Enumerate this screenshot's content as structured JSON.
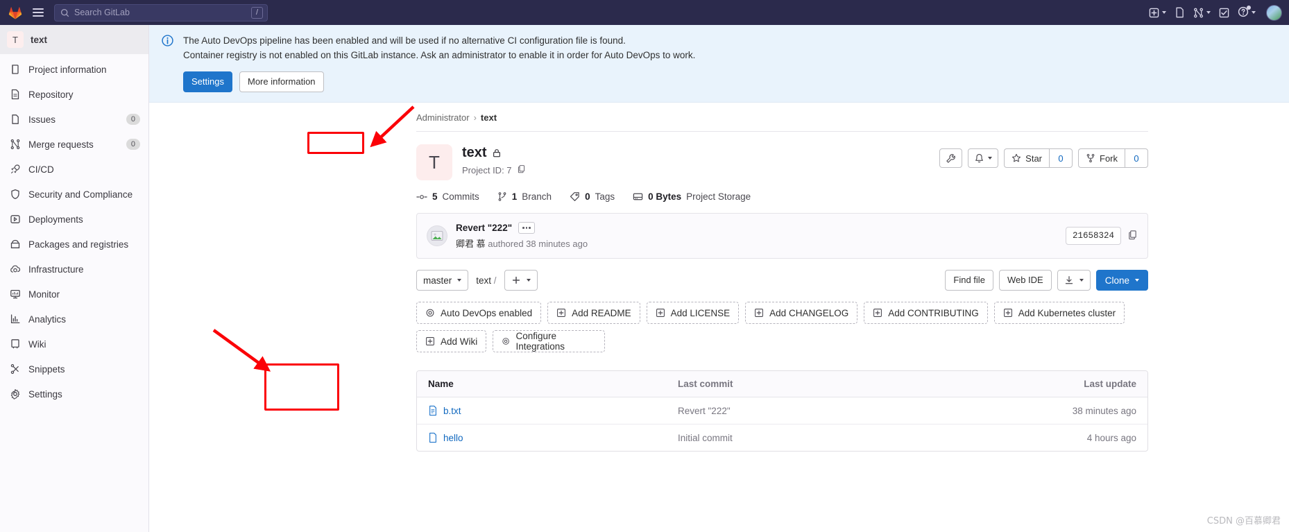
{
  "topnav": {
    "logo_icon": "gitlab-logo-icon",
    "menu_icon": "hamburger-menu-icon",
    "search": {
      "placeholder": "Search GitLab",
      "shortcut": "/"
    },
    "actions": [
      {
        "name": "create-new-menu",
        "icon": "plus-square-icon",
        "caret": true
      },
      {
        "name": "issues-link",
        "icon": "issues-icon",
        "caret": false
      },
      {
        "name": "merge-requests-menu",
        "icon": "merge-request-icon",
        "caret": true
      },
      {
        "name": "todos-link",
        "icon": "todo-check-icon",
        "caret": false
      },
      {
        "name": "help-menu",
        "icon": "question-circle-icon",
        "caret": true
      }
    ],
    "avatar": "user-avatar"
  },
  "sidebar": {
    "project": {
      "initial": "T",
      "name": "text"
    },
    "items": [
      {
        "label": "Project information",
        "icon": "info-book-icon",
        "badge": ""
      },
      {
        "label": "Repository",
        "icon": "document-icon",
        "badge": ""
      },
      {
        "label": "Issues",
        "icon": "issues-icon",
        "badge": "0"
      },
      {
        "label": "Merge requests",
        "icon": "merge-request-icon",
        "badge": "0"
      },
      {
        "label": "CI/CD",
        "icon": "rocket-icon",
        "badge": ""
      },
      {
        "label": "Security and Compliance",
        "icon": "shield-icon",
        "badge": ""
      },
      {
        "label": "Deployments",
        "icon": "deployments-icon",
        "badge": ""
      },
      {
        "label": "Packages and registries",
        "icon": "package-icon",
        "badge": ""
      },
      {
        "label": "Infrastructure",
        "icon": "cloud-gear-icon",
        "badge": ""
      },
      {
        "label": "Monitor",
        "icon": "monitor-icon",
        "badge": ""
      },
      {
        "label": "Analytics",
        "icon": "chart-icon",
        "badge": ""
      },
      {
        "label": "Wiki",
        "icon": "book-icon",
        "badge": ""
      },
      {
        "label": "Snippets",
        "icon": "snippet-icon",
        "badge": ""
      },
      {
        "label": "Settings",
        "icon": "gear-icon",
        "badge": ""
      }
    ]
  },
  "alert": {
    "icon": "info-circle-icon",
    "line1": "The Auto DevOps pipeline has been enabled and will be used if no alternative CI configuration file is found.",
    "line2": "Container registry is not enabled on this GitLab instance. Ask an administrator to enable it in order for Auto DevOps to work.",
    "settings_label": "Settings",
    "more_info_label": "More information"
  },
  "breadcrumb": {
    "owner": "Administrator",
    "separator": "›",
    "project": "text"
  },
  "project": {
    "initial": "T",
    "title": "text",
    "visibility_icon": "lock-icon",
    "project_id_label": "Project ID: 7",
    "copy_icon": "copy-to-clipboard-icon",
    "actions": {
      "wrench_icon": "wrench-icon",
      "notifications_icon": "bell-icon",
      "star_label": "Star",
      "star_count": "0",
      "fork_label": "Fork",
      "fork_count": "0"
    }
  },
  "stats": [
    {
      "icon": "commit-icon",
      "value": "5",
      "label": "Commits"
    },
    {
      "icon": "branch-icon",
      "value": "1",
      "label": "Branch"
    },
    {
      "icon": "tag-icon",
      "value": "0",
      "label": "Tags"
    },
    {
      "icon": "storage-icon",
      "value": "0 Bytes",
      "label": "Project Storage"
    }
  ],
  "last_commit": {
    "avatar": "commit-author-avatar",
    "title": "Revert \"222\"",
    "expand_icon": "ellipsis-icon",
    "author": "卿君 慕",
    "meta_suffix": "authored 38 minutes ago",
    "sha": "21658324",
    "copy_icon": "copy-sha-icon"
  },
  "repo_controls": {
    "branch": "master",
    "path_project": "text",
    "path_slash": "/",
    "add_icon": "plus-icon",
    "find_file": "Find file",
    "web_ide": "Web IDE",
    "download_icon": "download-icon",
    "clone_label": "Clone"
  },
  "setup_buttons": [
    {
      "label": "Auto DevOps enabled",
      "icon": "gear-icon"
    },
    {
      "label": "Add README",
      "icon": "plus-box-icon"
    },
    {
      "label": "Add LICENSE",
      "icon": "plus-box-icon"
    },
    {
      "label": "Add CHANGELOG",
      "icon": "plus-box-icon"
    },
    {
      "label": "Add CONTRIBUTING",
      "icon": "plus-box-icon"
    },
    {
      "label": "Add Kubernetes cluster",
      "icon": "plus-box-icon"
    },
    {
      "label": "Add Wiki",
      "icon": "plus-box-icon"
    },
    {
      "label": "Configure Integrations",
      "icon": "gear-icon"
    }
  ],
  "files": {
    "headers": {
      "name": "Name",
      "last_commit": "Last commit",
      "last_update": "Last update"
    },
    "rows": [
      {
        "name": "b.txt",
        "icon": "text-file-icon",
        "last_commit": "Revert \"222\"",
        "last_update": "38 minutes ago"
      },
      {
        "name": "hello",
        "icon": "file-icon",
        "last_commit": "Initial commit",
        "last_update": "4 hours ago"
      }
    ]
  },
  "annotations": {
    "color": "#fb0007",
    "title_box": "highlight-project-title",
    "title_arrow": "arrow-to-project-title",
    "files_box": "highlight-file-names",
    "files_arrow": "arrow-to-file-names"
  },
  "watermark": "CSDN @百慕卿君"
}
